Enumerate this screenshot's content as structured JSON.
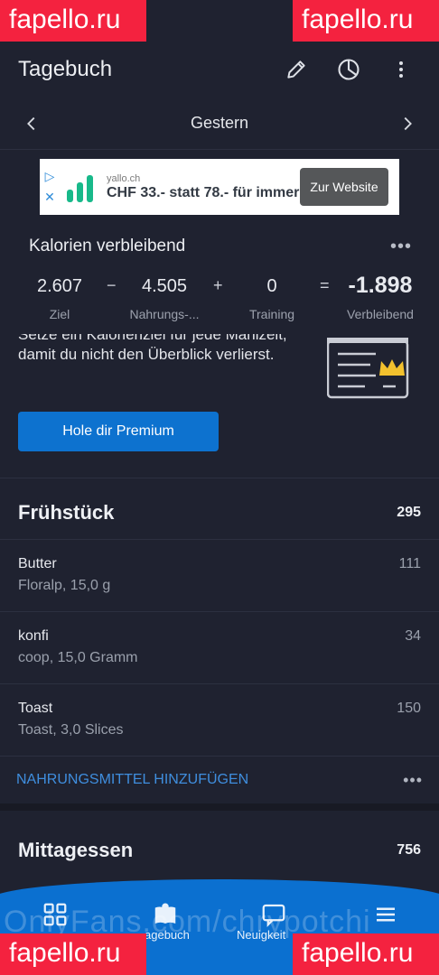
{
  "watermarks": {
    "top_left": "fapello.ru",
    "top_right": "fapello.ru",
    "bottom_left": "fapello.ru",
    "bottom_right": "fapello.ru",
    "overlay": "OnlyFans.com/chrypotchi"
  },
  "appbar": {
    "title": "Tagebuch",
    "icons": [
      "pencil-icon",
      "pie-chart-icon",
      "more-vertical-icon"
    ]
  },
  "datebar": {
    "date": "Gestern"
  },
  "ad": {
    "domain": "yallo.ch",
    "headline": "CHF 33.- statt 78.- für immer",
    "cta": "Zur Website",
    "brand_color": "#18b98a"
  },
  "calories": {
    "title": "Kalorien verbleibend",
    "goal": {
      "value": "2.607",
      "label": "Ziel"
    },
    "food": {
      "value": "4.505",
      "label": "Nahrungs-..."
    },
    "exercise": {
      "value": "0",
      "label": "Training"
    },
    "remaining": {
      "value": "-1.898",
      "label": "Verbleibend"
    },
    "ops": {
      "minus": "−",
      "plus": "+",
      "equals": "="
    }
  },
  "promo": {
    "text": "Setze ein Kalorienziel für jede Mahlzeit, damit du nicht den Überblick verlierst.",
    "button": "Hole dir Premium"
  },
  "breakfast": {
    "title": "Frühstück",
    "total": "295",
    "items": [
      {
        "name": "Butter",
        "desc": "Floralp, 15,0 g",
        "kcal": "111"
      },
      {
        "name": "konfi",
        "desc": "coop, 15,0 Gramm",
        "kcal": "34"
      },
      {
        "name": "Toast",
        "desc": "Toast, 3,0 Slices",
        "kcal": "150"
      }
    ],
    "add_label": "NAHRUNGSMITTEL HINZUFÜGEN"
  },
  "lunch": {
    "title": "Mittagessen",
    "total": "756"
  },
  "bottomnav": {
    "items": [
      "agebuch",
      "Neuigkeit"
    ],
    "accent": "#0b70d0"
  }
}
